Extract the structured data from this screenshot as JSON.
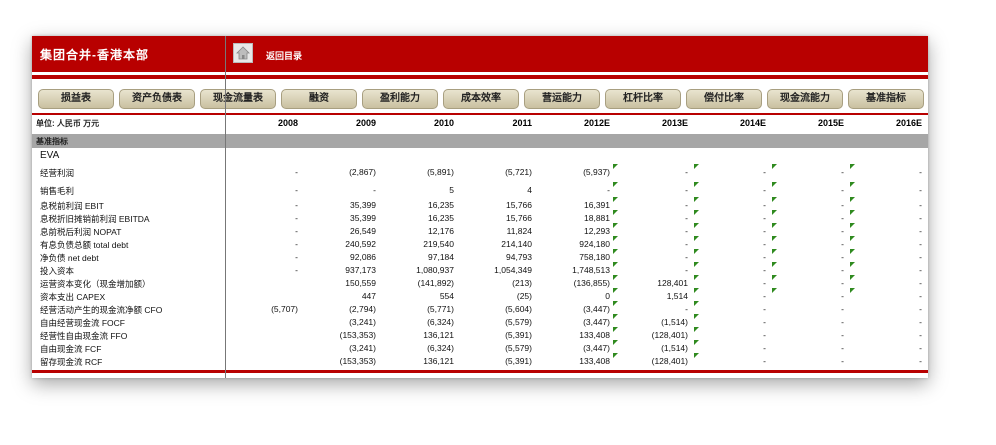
{
  "header": {
    "title": "集团合并-香港本部",
    "back_label": "返回目录"
  },
  "tabs": [
    "损益表",
    "资产负债表",
    "现金流量表",
    "融资",
    "盈利能力",
    "成本效率",
    "营运能力",
    "杠杆比率",
    "偿付比率",
    "现金流能力",
    "基准指标"
  ],
  "unit_label": "单位: 人民币 万元",
  "years": [
    "2008",
    "2009",
    "2010",
    "2011",
    "2012E",
    "2013E",
    "2014E",
    "2015E",
    "2016E"
  ],
  "section_label": "基准指标",
  "rows": [
    {
      "label": "EVA",
      "values": [
        "",
        "",
        "",
        "",
        "",
        "",
        "",
        "",
        ""
      ]
    },
    {
      "label": "经营利润",
      "values": [
        "-",
        "(2,867)",
        "(5,891)",
        "(5,721)",
        "(5,937)",
        "-",
        "-",
        "-",
        "-"
      ]
    },
    {
      "label": "销售毛利",
      "values": [
        "-",
        "-",
        "5",
        "4",
        "-",
        "-",
        "-",
        "-",
        "-"
      ]
    },
    {
      "label": "息税前利润 EBIT",
      "values": [
        "-",
        "35,399",
        "16,235",
        "15,766",
        "16,391",
        "-",
        "-",
        "-",
        "-"
      ]
    },
    {
      "label": "息税折旧摊销前利润 EBITDA",
      "values": [
        "-",
        "35,399",
        "16,235",
        "15,766",
        "18,881",
        "-",
        "-",
        "-",
        "-"
      ]
    },
    {
      "label": "息前税后利润 NOPAT",
      "values": [
        "-",
        "26,549",
        "12,176",
        "11,824",
        "12,293",
        "-",
        "-",
        "-",
        "-"
      ]
    },
    {
      "label": "有息负债总额 total debt",
      "values": [
        "-",
        "240,592",
        "219,540",
        "214,140",
        "924,180",
        "-",
        "-",
        "-",
        "-"
      ]
    },
    {
      "label": "净负债 net debt",
      "values": [
        "-",
        "92,086",
        "97,184",
        "94,793",
        "758,180",
        "-",
        "-",
        "-",
        "-"
      ]
    },
    {
      "label": "投入资本",
      "values": [
        "-",
        "937,173",
        "1,080,937",
        "1,054,349",
        "1,748,513",
        "-",
        "-",
        "-",
        "-"
      ]
    },
    {
      "label": "运营资本变化（现金增加额）",
      "values": [
        "",
        "150,559",
        "(141,892)",
        "(213)",
        "(136,855)",
        "128,401",
        "-",
        "-",
        "-"
      ]
    },
    {
      "label": "资本支出 CAPEX",
      "values": [
        "",
        "447",
        "554",
        "(25)",
        "0",
        "1,514",
        "-",
        "-",
        "-"
      ]
    },
    {
      "label": "经营活动产生的现金流净额 CFO",
      "values": [
        "(5,707)",
        "(2,794)",
        "(5,771)",
        "(5,604)",
        "(3,447)",
        "-",
        "-",
        "-",
        "-"
      ]
    },
    {
      "label": "自由经营现金流 FOCF",
      "values": [
        "",
        "(3,241)",
        "(6,324)",
        "(5,579)",
        "(3,447)",
        "(1,514)",
        "-",
        "-",
        "-"
      ]
    },
    {
      "label": "经营性自由现金流 FFO",
      "values": [
        "",
        "(153,353)",
        "136,121",
        "(5,391)",
        "133,408",
        "(128,401)",
        "-",
        "-",
        "-"
      ]
    },
    {
      "label": "自由现金流 FCF",
      "values": [
        "",
        "(3,241)",
        "(6,324)",
        "(5,579)",
        "(3,447)",
        "(1,514)",
        "-",
        "-",
        "-"
      ]
    },
    {
      "label": "留存现金流 RCF",
      "values": [
        "",
        "(153,353)",
        "136,121",
        "(5,391)",
        "133,408",
        "(128,401)",
        "-",
        "-",
        "-"
      ]
    }
  ],
  "colors": {
    "header_red": "#b80000",
    "tab_beige": "#d8d0b4",
    "section_gray": "#a6a6a6",
    "marker_green": "#2f8a1f"
  },
  "icons": {
    "home": "home-icon",
    "cell_marker": "comment-marker-icon"
  }
}
